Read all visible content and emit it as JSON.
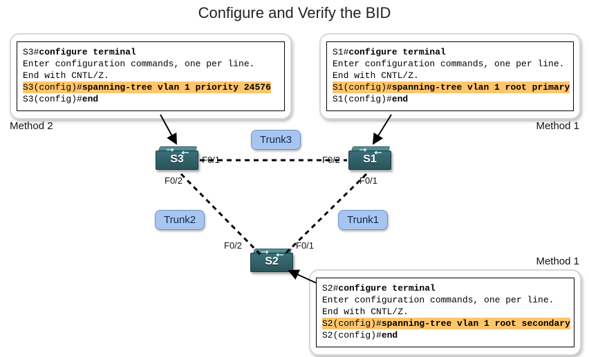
{
  "title": "Configure and Verify the BID",
  "methods": {
    "left_label": "Method 2",
    "right_top_label": "Method 1",
    "right_bottom_label": "Method 1"
  },
  "cli": {
    "s3": {
      "l1_prompt": "S3#",
      "l1_cmd": "configure terminal",
      "l2": "Enter configuration commands, one per line.",
      "l3": "End with CNTL/Z.",
      "l4_prompt": "S3(config)#",
      "l4_cmd": "spanning-tree vlan 1 priority 24576",
      "l5_prompt": "S3(config)#",
      "l5_cmd": "end"
    },
    "s1": {
      "l1_prompt": "S1#",
      "l1_cmd": "configure terminal",
      "l2": "Enter configuration commands, one per line.",
      "l3": "End with CNTL/Z.",
      "l4_prompt": "S1(config)#",
      "l4_cmd": "spanning-tree vlan 1 root primary",
      "l5_prompt": "S1(config)#",
      "l5_cmd": "end"
    },
    "s2": {
      "l1_prompt": "S2#",
      "l1_cmd": "configure terminal",
      "l2": "Enter configuration commands, one per line.",
      "l3": "End with CNTL/Z.",
      "l4_prompt": "S2(config)#",
      "l4_cmd": "spanning-tree vlan 1 root secondary",
      "l5_prompt": "S2(config)#",
      "l5_cmd": "end"
    }
  },
  "trunks": {
    "t1": "Trunk1",
    "t2": "Trunk2",
    "t3": "Trunk3"
  },
  "switches": {
    "s1": "S1",
    "s2": "S2",
    "s3": "S3"
  },
  "ports": {
    "s3_f01": "F0/1",
    "s3_f02": "F0/2",
    "s1_f01": "F0/1",
    "s1_f02": "F0/2",
    "s2_f01": "F0/1",
    "s2_f02": "F0/2"
  }
}
